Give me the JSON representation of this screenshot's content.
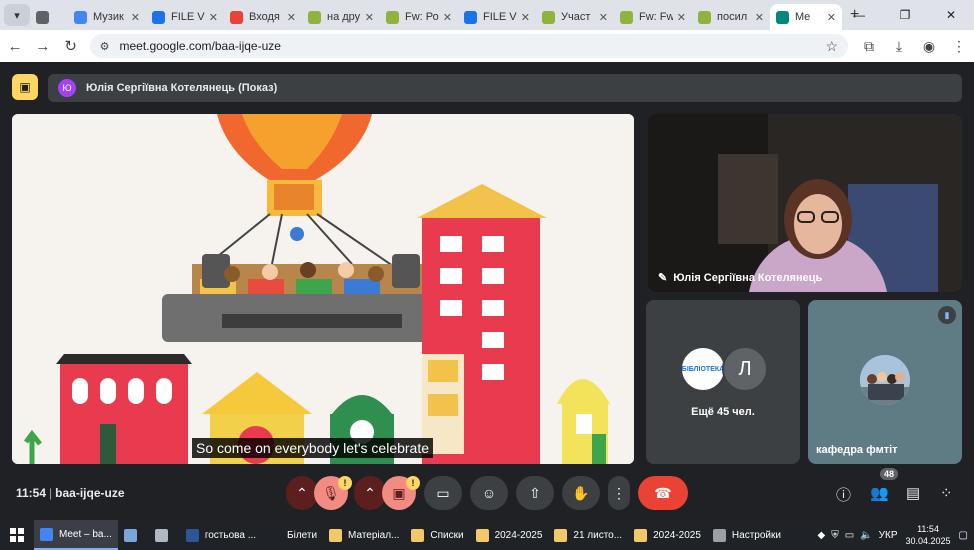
{
  "browser": {
    "tabs": [
      {
        "label": "",
        "icon": "tab-globe-icon"
      },
      {
        "label": "Музик",
        "icon": "tab-doc-icon"
      },
      {
        "label": "FILE Vi",
        "icon": "tab-file-icon"
      },
      {
        "label": "Входя",
        "icon": "tab-gmail-icon"
      },
      {
        "label": "на дру",
        "icon": "tab-drive-icon"
      },
      {
        "label": "Fw: Ро",
        "icon": "tab-drive-icon"
      },
      {
        "label": "FILE Vi",
        "icon": "tab-file-icon"
      },
      {
        "label": "Участ",
        "icon": "tab-drive-icon"
      },
      {
        "label": "Fw: Fw",
        "icon": "tab-drive-icon"
      },
      {
        "label": "посил",
        "icon": "tab-drive-icon"
      },
      {
        "label": "Me",
        "icon": "tab-meet-icon",
        "active": true
      }
    ],
    "url": "meet.google.com/baa-ijqe-uze"
  },
  "meet": {
    "presenter_initial": "Ю",
    "presenter_label": "Юлія Сергіївна Котелянець (Показ)",
    "caption": "So come on everybody let's celebrate",
    "main_tile_name": "Юлія Сергіївна Котелянець",
    "more_label": "Ещё 45 чел.",
    "more_avatar_text": "БІБЛІОТЕКА",
    "more_avatar_letter": "Л",
    "kaf_name": "кафедра фмтіт",
    "time": "11:54",
    "meeting_code": "baa-ijqe-uze",
    "people_count": "48",
    "warn_mark": "!"
  },
  "taskbar": {
    "items": [
      {
        "label": "Meet – ba...",
        "color": "#4285f4",
        "active": true
      },
      {
        "label": "",
        "color": "#7aa6d8"
      },
      {
        "label": "",
        "color": "#b0b8c4"
      },
      {
        "label": "гостьова ...",
        "color": "#2b579a"
      },
      {
        "label": "Білети",
        "color": "#1f2226"
      },
      {
        "label": "Матеріал...",
        "color": "#f3c86b"
      },
      {
        "label": "Списки",
        "color": "#f3c86b"
      },
      {
        "label": "2024-2025",
        "color": "#f3c86b"
      },
      {
        "label": "21 листо...",
        "color": "#f3c86b"
      },
      {
        "label": "2024-2025",
        "color": "#f3c86b"
      },
      {
        "label": "Настройки",
        "color": "#9aa0a6"
      }
    ],
    "lang": "УКР",
    "clock_time": "11:54",
    "clock_date": "30.04.2025"
  }
}
